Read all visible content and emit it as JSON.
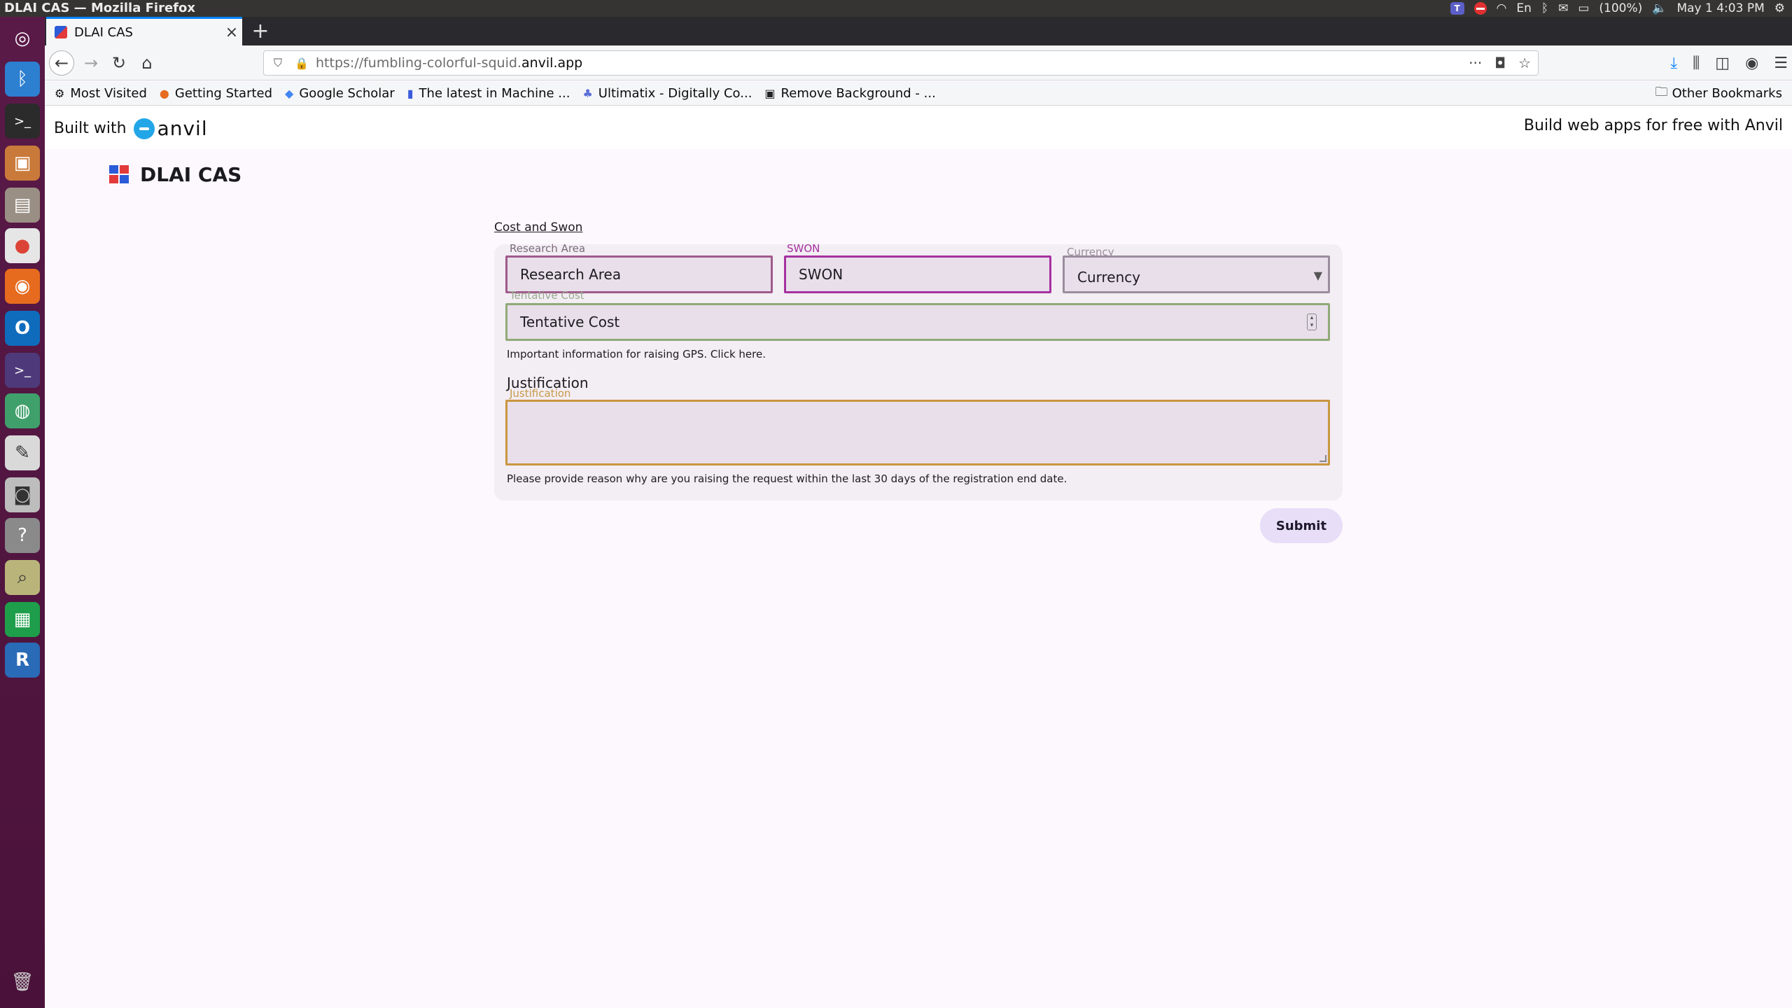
{
  "os": {
    "window_title": "DLAI CAS — Mozilla Firefox",
    "tray": {
      "keyboard": "En",
      "battery": "(100%)",
      "datetime": "May 1  4:03 PM"
    }
  },
  "browser": {
    "tab": {
      "label": "DLAI CAS"
    },
    "url_prefix": "https://fumbling-colorful-squid.",
    "url_domain": "anvil.app",
    "bookmarks": [
      {
        "label": "Most Visited",
        "icon": "gear-icon"
      },
      {
        "label": "Getting Started",
        "icon": "firefox-icon"
      },
      {
        "label": "Google Scholar",
        "icon": "scholar-icon"
      },
      {
        "label": "The latest in Machine ...",
        "icon": "bookmark-icon"
      },
      {
        "label": "Ultimatix - Digitally Co...",
        "icon": "ultimatix-icon"
      },
      {
        "label": "Remove Background - ...",
        "icon": "removebg-icon"
      }
    ],
    "other_bookmarks": "Other Bookmarks"
  },
  "banner": {
    "built_with": "Built with",
    "brand": "anvil",
    "cta": "Build web apps for free with Anvil"
  },
  "app": {
    "title": "DLAI CAS",
    "section_link": "Cost and Swon",
    "form": {
      "research_area": {
        "label": "Research Area",
        "value": "Research Area"
      },
      "swon": {
        "label": "SWON",
        "value": "SWON"
      },
      "currency": {
        "label": "Currency",
        "value": "Currency"
      },
      "tentative_cost": {
        "label": "Tentative Cost",
        "value": "Tentative Cost"
      },
      "gps_hint": "Important information for raising GPS. Click here.",
      "justification_heading": "Justification",
      "justification": {
        "label": "Justification",
        "value": ""
      },
      "justification_hint": "Please provide reason why are you raising the request within the last 30 days of the registration end date.",
      "submit": "Submit"
    }
  },
  "colors": {
    "launcher": "#5a1a48",
    "swon_accent": "#a531a0",
    "cost_border": "#8faa78",
    "justification_border": "#c9963f",
    "submit_bg": "#e8def8"
  }
}
